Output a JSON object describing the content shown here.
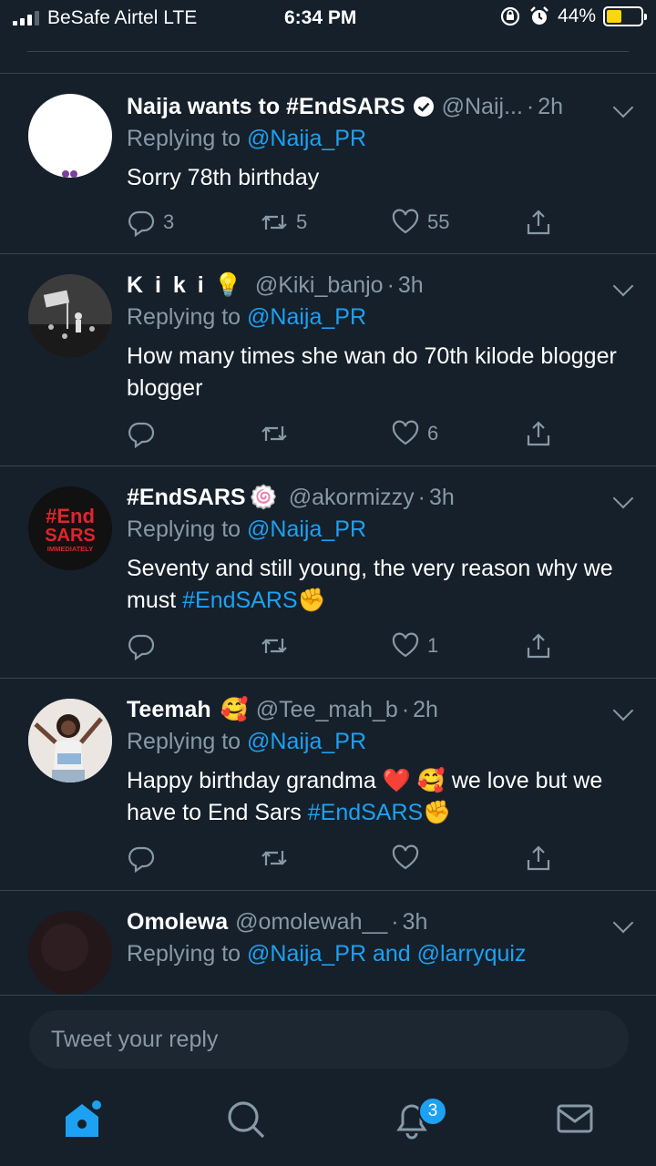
{
  "status_bar": {
    "carrier": "BeSafe Airtel  LTE",
    "time": "6:34 PM",
    "battery": "44%",
    "battery_level": 0.44
  },
  "tweets": [
    {
      "name": "Naija wants to #EndSARS",
      "verified": true,
      "handle": "@Naij...",
      "time": "2h",
      "replying_prefix": "Replying to ",
      "replying_to": "@Naija_PR",
      "text": "Sorry 78th birthday",
      "replies": "3",
      "retweets": "5",
      "likes": "55"
    },
    {
      "name": "K i k i",
      "emoji": "💡",
      "handle": "@Kiki_banjo",
      "time": "3h",
      "replying_prefix": "Replying to ",
      "replying_to": "@Naija_PR",
      "text": "How many times she wan do 70th kilode blogger blogger",
      "replies": "",
      "retweets": "",
      "likes": "6"
    },
    {
      "name": "#EndSARS",
      "emoji": "🍥",
      "handle": "@akormizzy",
      "time": "3h",
      "replying_prefix": "Replying to ",
      "replying_to": "@Naija_PR",
      "text_plain": "Seventy and still young, the very reason why we must ",
      "text_tag": "#EndSARS",
      "text_emoji": "✊",
      "replies": "",
      "retweets": "",
      "likes": "1",
      "avatar_text_1": "#End",
      "avatar_text_2": "SARS",
      "avatar_text_3": "IMMEDIATELY"
    },
    {
      "name": "Teemah",
      "emoji": "🥰",
      "handle": "@Tee_mah_b",
      "time": "2h",
      "replying_prefix": "Replying to ",
      "replying_to": "@Naija_PR",
      "text_plain": "Happy birthday grandma ❤️ 🥰 we love but we have to End Sars ",
      "text_tag": "#EndSARS",
      "text_emoji": "✊",
      "replies": "",
      "retweets": "",
      "likes": ""
    },
    {
      "name": "Omolewa",
      "handle": "@omolewah__",
      "time": "3h",
      "replying_prefix": "Replying to ",
      "replying_to": "@Naija_PR and @larryquiz"
    }
  ],
  "reply_bar": {
    "placeholder": "Tweet your reply"
  },
  "tabbar": {
    "notifications_badge": "3"
  },
  "colors": {
    "background": "#15202b",
    "accent": "#1da1f2",
    "secondary_text": "#8899a6",
    "divider": "#38444d"
  }
}
